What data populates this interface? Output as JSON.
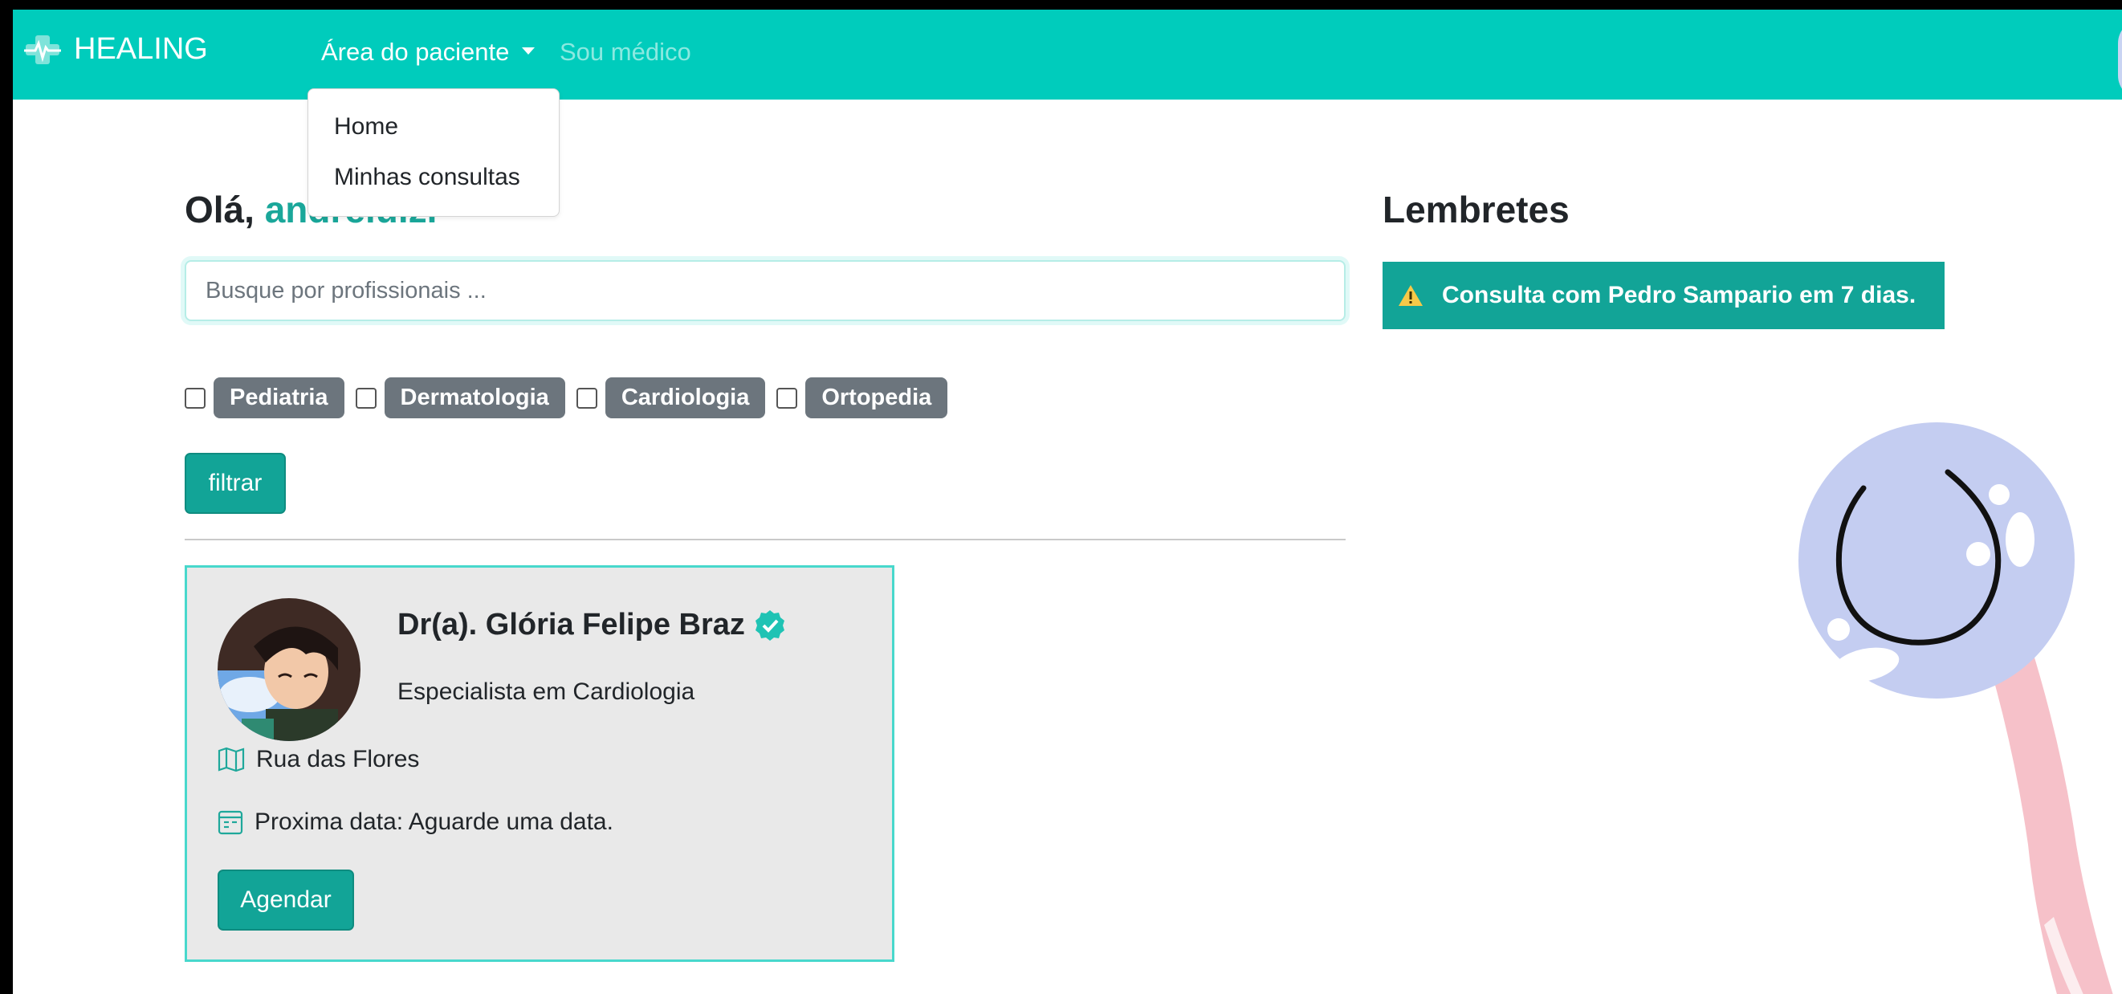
{
  "navbar": {
    "brand": "HEALING",
    "patient_area": "Área do paciente",
    "doctor_link": "Sou médico",
    "dropdown": [
      "Home",
      "Minhas consultas"
    ]
  },
  "main": {
    "greeting_prefix": "Olá,",
    "username": "andreluiz.",
    "search_placeholder": "Busque por profissionais ...",
    "filters": [
      "Pediatria",
      "Dermatologia",
      "Cardiologia",
      "Ortopedia"
    ],
    "filter_button": "filtrar"
  },
  "doctors": [
    {
      "name": "Dr(a). Glória Felipe Braz",
      "specialty": "Especialista em Cardiologia",
      "address": "Rua das Flores",
      "next_date": "Proxima data: Aguarde uma data.",
      "schedule_button": "Agendar"
    }
  ],
  "reminders": {
    "title": "Lembretes",
    "items": [
      "Consulta com Pedro Sampario em 7 dias."
    ]
  },
  "colors": {
    "primary": "#00ccbc",
    "button": "#12a497",
    "tag": "#6c757d"
  }
}
